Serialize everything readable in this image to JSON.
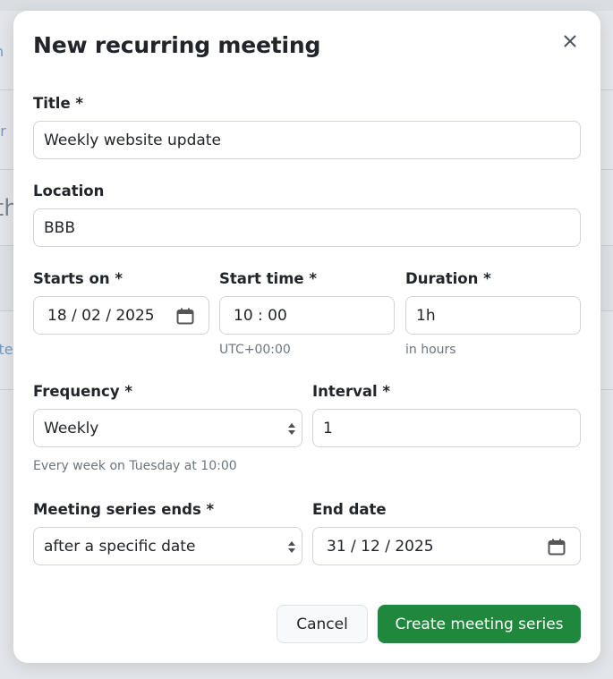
{
  "background": {
    "fragments": [
      "n",
      "tr",
      "th",
      "ite"
    ]
  },
  "modal": {
    "title": "New recurring meeting",
    "close_icon": "close-icon",
    "fields": {
      "title": {
        "label": "Title *",
        "value": "Weekly website update"
      },
      "location": {
        "label": "Location",
        "value": "BBB"
      },
      "starts_on": {
        "label": "Starts on *",
        "value": "18 / 02 / 2025",
        "icon": "calendar-icon"
      },
      "start_time": {
        "label": "Start time *",
        "value": "10 : 00",
        "help": "UTC+00:00"
      },
      "duration": {
        "label": "Duration *",
        "value": "1h",
        "help": "in hours"
      },
      "frequency": {
        "label": "Frequency *",
        "value": "Weekly",
        "help": "Every week on Tuesday at 10:00",
        "icon": "select-arrows-icon"
      },
      "interval": {
        "label": "Interval *",
        "value": "1"
      },
      "series_ends": {
        "label": "Meeting series ends *",
        "value": "after a specific date",
        "icon": "select-arrows-icon"
      },
      "end_date": {
        "label": "End date",
        "value": "31 / 12 / 2025",
        "icon": "calendar-icon"
      }
    },
    "buttons": {
      "cancel": "Cancel",
      "create": "Create meeting series"
    }
  },
  "colors": {
    "primary_green": "#1f883d",
    "link_blue": "#6f9bc6",
    "muted_text": "#6c757d",
    "border": "#ced4da"
  }
}
